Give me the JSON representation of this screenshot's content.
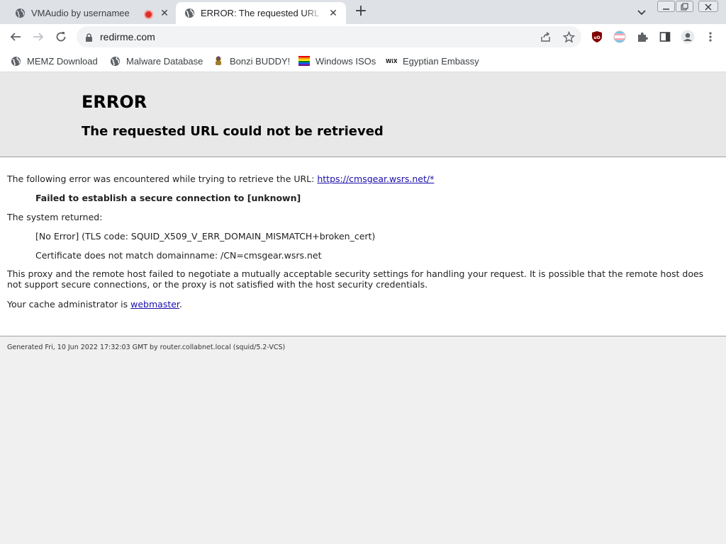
{
  "tabs": [
    {
      "title": "VMAudio by usernamee",
      "recording": true
    },
    {
      "title": "ERROR: The requested URL could not be retrieved"
    }
  ],
  "address": {
    "url": "redirme.com"
  },
  "bookmarks": [
    {
      "label": "MEMZ Download",
      "icon": "globe-icon"
    },
    {
      "label": "Malware Database",
      "icon": "globe-icon"
    },
    {
      "label": "Bonzi BUDDY!",
      "icon": "bonzi-icon"
    },
    {
      "label": "Windows ISOs",
      "icon": "rainbow-flag-icon"
    },
    {
      "label": "Egyptian Embassy",
      "icon": "wix-icon"
    }
  ],
  "page": {
    "heading": "ERROR",
    "subheading": "The requested URL could not be retrieved",
    "intro": "The following error was encountered while trying to retrieve the URL:",
    "url_link": "https://cmsgear.wsrs.net/*",
    "error_title": "Failed to establish a secure connection to [unknown]",
    "system_returned": "The system returned:",
    "tls_code": "[No Error] (TLS code: SQUID_X509_V_ERR_DOMAIN_MISMATCH+broken_cert)",
    "cert_msg": "Certificate does not match domainname: /CN=cmsgear.wsrs.net",
    "explanation": "This proxy and the remote host failed to negotiate a mutually acceptable security settings for handling your request. It is possible that the remote host does not support secure connections, or the proxy is not satisfied with the host security credentials.",
    "admin_prefix": "Your cache administrator is",
    "admin_link": "webmaster",
    "admin_suffix": ".",
    "footer": "Generated Fri, 10 Jun 2022 17:32:03 GMT by router.collabnet.local (squid/5.2-VCS)"
  },
  "colors": {
    "tabstrip": "#dee1e6",
    "link": "#1a0dab",
    "record": "#d93025",
    "ublock": "#800000"
  }
}
